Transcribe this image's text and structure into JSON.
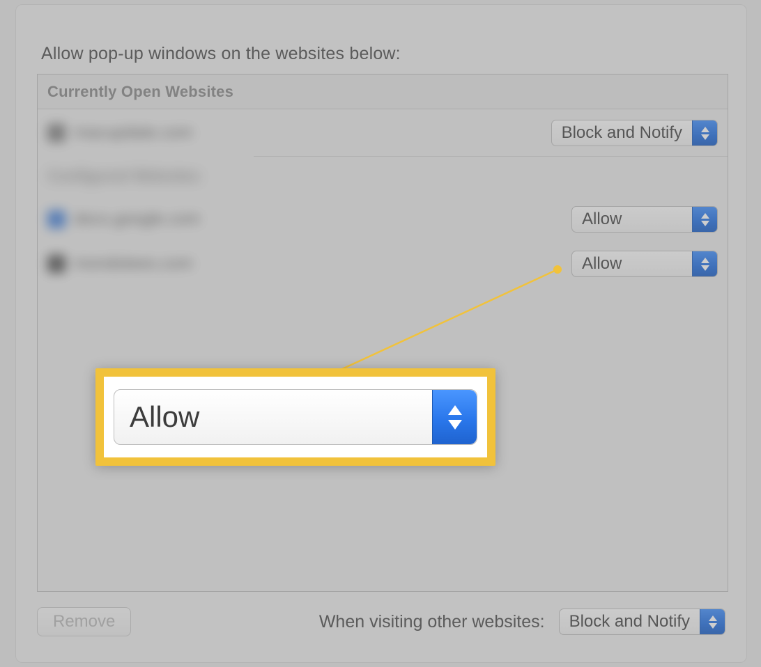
{
  "heading": "Allow pop-up windows on the websites below:",
  "section_header": "Currently Open Websites",
  "subheader_blurred": "Configured Websites",
  "rows": [
    {
      "site_blurred": "macupdate.com",
      "select": "Block and Notify",
      "favicon_color": "#6d6d6d"
    },
    {
      "site_blurred": "docs.google.com",
      "select": "Allow",
      "favicon_color": "#2a6fd6"
    },
    {
      "site_blurred": "mondotees.com",
      "select": "Allow",
      "favicon_color": "#3b3b3b"
    }
  ],
  "remove_button": "Remove",
  "footer_label": "When visiting other websites:",
  "footer_select": "Block and Notify",
  "callout_select": "Allow"
}
